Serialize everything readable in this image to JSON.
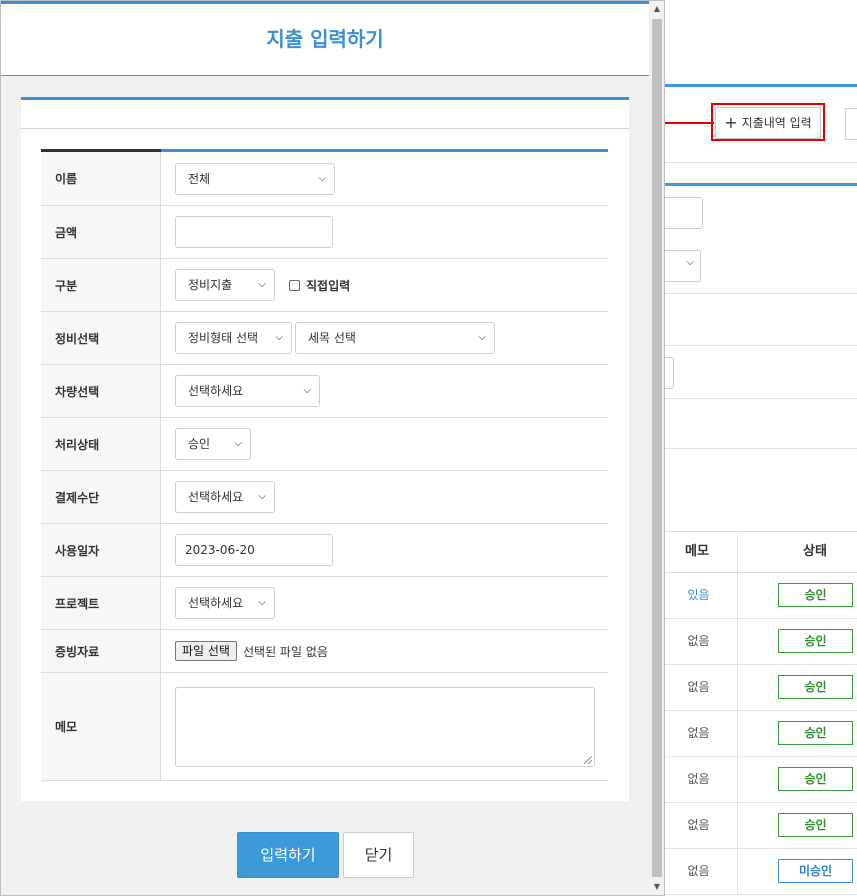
{
  "modal": {
    "title": "지출 입력하기",
    "fields": {
      "name": {
        "label": "이름",
        "value": "전체"
      },
      "amount": {
        "label": "금액",
        "value": ""
      },
      "category": {
        "label": "구분",
        "value": "정비지출",
        "checkbox_label": "직접입력",
        "checked": false
      },
      "maintenance": {
        "label": "정비선택",
        "type_value": "정비형태 선택",
        "detail_value": "세목 선택"
      },
      "vehicle": {
        "label": "차량선택",
        "value": "선택하세요"
      },
      "status": {
        "label": "처리상태",
        "value": "승인"
      },
      "payment": {
        "label": "결제수단",
        "value": "선택하세요"
      },
      "date": {
        "label": "사용일자",
        "value": "2023-06-20"
      },
      "project": {
        "label": "프로젝트",
        "value": "선택하세요"
      },
      "evidence": {
        "label": "증빙자료",
        "button": "파일 선택",
        "status": "선택된 파일 없음"
      },
      "memo": {
        "label": "메모",
        "value": ""
      }
    },
    "buttons": {
      "submit": "입력하기",
      "close": "닫기"
    }
  },
  "background": {
    "add_button": "지출내역 입력",
    "table": {
      "headers": {
        "memo": "메모",
        "status": "상태"
      },
      "rows": [
        {
          "memo": "있음",
          "status": "승인"
        },
        {
          "memo": "없음",
          "status": "승인"
        },
        {
          "memo": "없음",
          "status": "승인"
        },
        {
          "memo": "없음",
          "status": "승인"
        },
        {
          "memo": "없음",
          "status": "승인"
        },
        {
          "memo": "없음",
          "status": "승인"
        },
        {
          "memo": "없음",
          "status": "미승인"
        }
      ]
    }
  },
  "colors": {
    "accent": "#3d8fd1",
    "highlight": "#e00000",
    "approved": "#2f8f2f",
    "pending": "#2f7fc7"
  }
}
